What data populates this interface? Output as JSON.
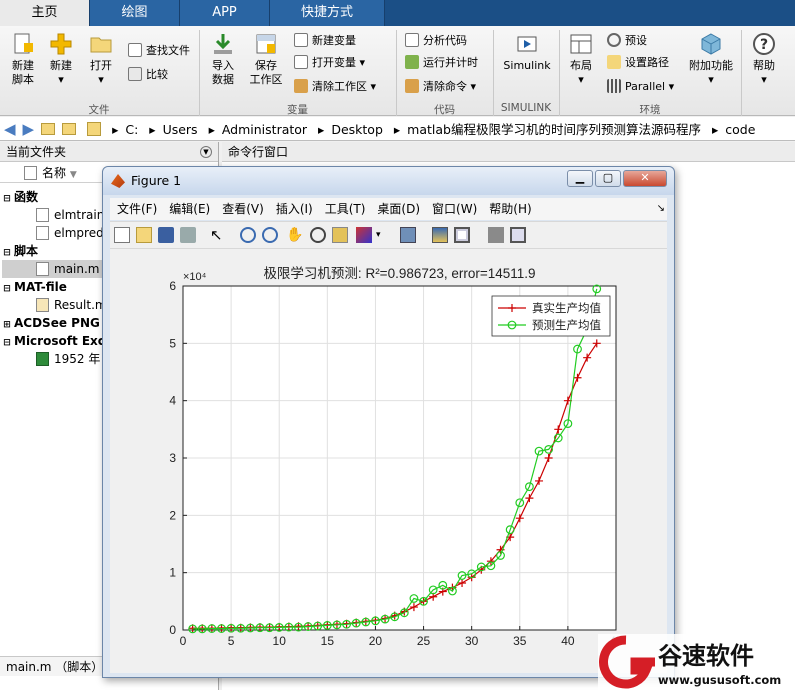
{
  "tabs": [
    "主页",
    "绘图",
    "APP",
    "快捷方式"
  ],
  "ribbon": {
    "file": {
      "new_script": "新建\n脚本",
      "new": "新建",
      "open": "打开",
      "find_files": "查找文件",
      "compare": "比较",
      "group": "文件"
    },
    "variable": {
      "import": "导入\n数据",
      "save_ws": "保存\n工作区",
      "new_var": "新建变量",
      "open_var": "打开变量",
      "clear_ws": "清除工作区",
      "group": "变量"
    },
    "code": {
      "analyze": "分析代码",
      "run_time": "运行并计时",
      "clear_cmd": "清除命令",
      "group": "代码"
    },
    "simulink": {
      "label": "Simulink",
      "group": "SIMULINK"
    },
    "env": {
      "layout": "布局",
      "prefs": "预设",
      "set_path": "设置路径",
      "parallel": "Parallel",
      "addons": "附加功能",
      "group": "环境"
    },
    "help": {
      "label": "帮助"
    }
  },
  "address": {
    "segments": [
      "C:",
      "Users",
      "Administrator",
      "Desktop",
      "matlab编程极限学习机的时间序列预测算法源码程序",
      "code"
    ]
  },
  "left_panel": {
    "title": "当前文件夹",
    "column": "名称",
    "groups": [
      {
        "name": "函数",
        "items": [
          "elmtrain",
          "elmpredi"
        ]
      },
      {
        "name": "脚本",
        "items": [
          "main.m"
        ]
      },
      {
        "name": "MAT-file",
        "items": [
          "Result.m"
        ]
      },
      {
        "name": "ACDSee PNG",
        "items": []
      },
      {
        "name": "Microsoft Exc",
        "items": [
          "1952 年"
        ]
      }
    ],
    "status": "main.m （脚本）"
  },
  "command_window": {
    "title": "命令行窗口"
  },
  "figure": {
    "title": "Figure 1",
    "menu": [
      "文件(F)",
      "编辑(E)",
      "查看(V)",
      "插入(I)",
      "工具(T)",
      "桌面(D)",
      "窗口(W)",
      "帮助(H)"
    ]
  },
  "chart_data": {
    "type": "line",
    "title": "极限学习机预测: R²=0.986723, error=14511.9",
    "exponent_label": "×10⁴",
    "xlim": [
      0,
      45
    ],
    "ylim": [
      0,
      6
    ],
    "xticks": [
      0,
      5,
      10,
      15,
      20,
      25,
      30,
      35,
      40,
      45
    ],
    "yticks": [
      0,
      1,
      2,
      3,
      4,
      5,
      6
    ],
    "grid": true,
    "legend_position": "top-right",
    "x": [
      1,
      2,
      3,
      4,
      5,
      6,
      7,
      8,
      9,
      10,
      11,
      12,
      13,
      14,
      15,
      16,
      17,
      18,
      19,
      20,
      21,
      22,
      23,
      24,
      25,
      26,
      27,
      28,
      29,
      30,
      31,
      32,
      33,
      34,
      35,
      36,
      37,
      38,
      39,
      40,
      41,
      42,
      43
    ],
    "series": [
      {
        "name": "真实生产均值",
        "color": "#cc0000",
        "marker": "plus",
        "values": [
          0.03,
          0.03,
          0.03,
          0.035,
          0.04,
          0.04,
          0.045,
          0.05,
          0.05,
          0.055,
          0.06,
          0.065,
          0.07,
          0.08,
          0.09,
          0.1,
          0.11,
          0.13,
          0.15,
          0.17,
          0.2,
          0.25,
          0.32,
          0.4,
          0.5,
          0.58,
          0.67,
          0.74,
          0.82,
          0.92,
          1.05,
          1.2,
          1.4,
          1.62,
          1.95,
          2.3,
          2.6,
          3.0,
          3.5,
          4.0,
          4.4,
          4.75,
          5.0
        ]
      },
      {
        "name": "预测生产均值",
        "color": "#22cc22",
        "marker": "circle",
        "values": [
          0.02,
          0.02,
          0.025,
          0.025,
          0.03,
          0.03,
          0.035,
          0.04,
          0.04,
          0.045,
          0.05,
          0.05,
          0.06,
          0.07,
          0.08,
          0.09,
          0.1,
          0.12,
          0.14,
          0.16,
          0.19,
          0.23,
          0.3,
          0.55,
          0.5,
          0.7,
          0.78,
          0.68,
          0.95,
          0.98,
          1.1,
          1.12,
          1.3,
          1.75,
          2.22,
          2.5,
          3.12,
          3.15,
          3.35,
          3.6,
          4.9,
          5.25,
          5.95
        ]
      }
    ]
  },
  "watermark": {
    "name": "谷速软件",
    "url": "www.gususoft.com"
  }
}
